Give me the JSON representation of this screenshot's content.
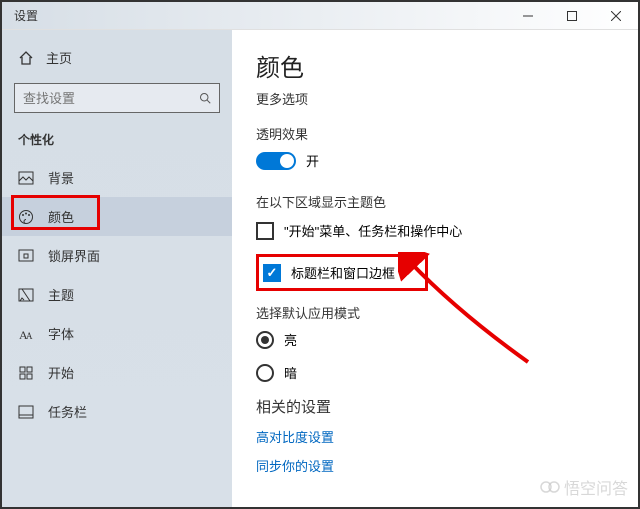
{
  "window": {
    "title": "设置"
  },
  "sidebar": {
    "home": "主页",
    "search_placeholder": "查找设置",
    "section": "个性化",
    "items": [
      {
        "label": "背景"
      },
      {
        "label": "颜色"
      },
      {
        "label": "锁屏界面"
      },
      {
        "label": "主题"
      },
      {
        "label": "字体"
      },
      {
        "label": "开始"
      },
      {
        "label": "任务栏"
      }
    ]
  },
  "main": {
    "title": "颜色",
    "more_options": "更多选项",
    "transparency_label": "透明效果",
    "toggle_state": "开",
    "accent_surfaces_label": "在以下区域显示主题色",
    "checkbox_start": "\"开始\"菜单、任务栏和操作中心",
    "checkbox_title": "标题栏和窗口边框",
    "app_mode_label": "选择默认应用模式",
    "radio_light": "亮",
    "radio_dark": "暗",
    "related_header": "相关的设置",
    "link_high_contrast": "高对比度设置",
    "link_sync": "同步你的设置"
  },
  "watermark": "悟空问答"
}
